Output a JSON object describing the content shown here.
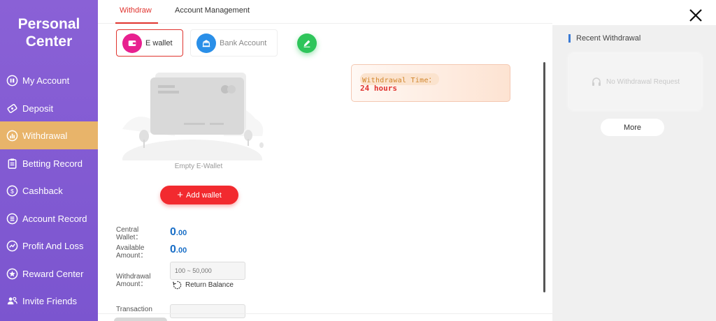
{
  "sidebar": {
    "title_line1": "Personal",
    "title_line2": "Center",
    "items": [
      {
        "label": "My Account",
        "icon": "account-icon"
      },
      {
        "label": "Deposit",
        "icon": "deposit-icon"
      },
      {
        "label": "Withdrawal",
        "icon": "withdrawal-icon",
        "active": true
      },
      {
        "label": "Betting Record",
        "icon": "clipboard-icon"
      },
      {
        "label": "Cashback",
        "icon": "cashback-icon"
      },
      {
        "label": "Account Record",
        "icon": "record-icon"
      },
      {
        "label": "Profit And Loss",
        "icon": "profit-icon"
      },
      {
        "label": "Reward Center",
        "icon": "star-icon"
      },
      {
        "label": "Invite Friends",
        "icon": "people-icon"
      }
    ]
  },
  "tabs": {
    "withdraw": "Withdraw",
    "account_management": "Account Management"
  },
  "methods": {
    "ewallet": "E wallet",
    "bank": "Bank Account"
  },
  "wallet": {
    "empty_text": "Empty E-Wallet",
    "add_button": "Add wallet"
  },
  "form": {
    "central_wallet_label": "Central Wallet：",
    "central_wallet_int": "0",
    "central_wallet_dec": ".00",
    "available_label": "Available Amount：",
    "available_int": "0",
    "available_dec": ".00",
    "withdrawal_amount_label": "Withdrawal Amount：",
    "withdrawal_placeholder": "100 ~ 50,000",
    "return_balance": "Return Balance",
    "transaction_label": "Transaction"
  },
  "withdrawal_time": {
    "label": "Withdrawal Time：",
    "value": "24 hours"
  },
  "recent": {
    "title": "Recent Withdrawal",
    "empty": "No Withdrawal Request",
    "more": "More"
  },
  "colors": {
    "sidebar": "#8a61d6",
    "active": "#e8b46a",
    "accent_red": "#e0342f",
    "amount_blue": "#1a6fc7"
  }
}
